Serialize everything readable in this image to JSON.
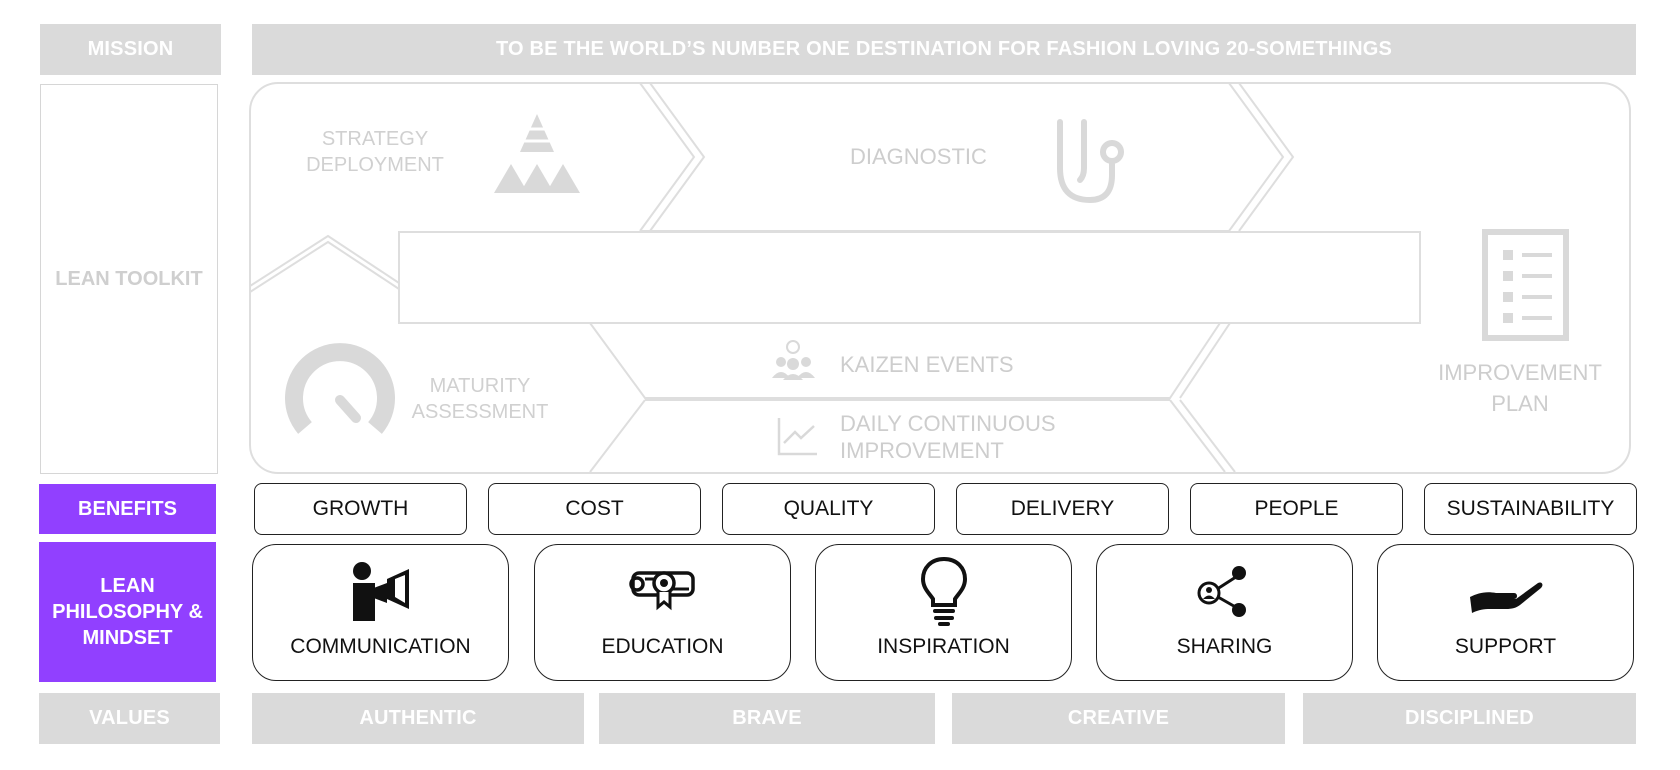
{
  "mission": {
    "label": "MISSION",
    "statement": "TO BE THE WORLD’S NUMBER ONE DESTINATION FOR FASHION LOVING 20-SOMETHINGS"
  },
  "toolkit": {
    "label": "LEAN TOOLKIT",
    "strategy": "STRATEGY DEPLOYMENT",
    "diagnostic": "DIAGNOSTIC",
    "maturity": "MATURITY ASSESSMENT",
    "kaizen": "KAIZEN EVENTS",
    "daily": "DAILY CONTINUOUS IMPROVEMENT",
    "improvement_plan": "IMPROVEMENT PLAN"
  },
  "benefits": {
    "label": "BENEFITS",
    "items": [
      "GROWTH",
      "COST",
      "QUALITY",
      "DELIVERY",
      "PEOPLE",
      "SUSTAINABILITY"
    ]
  },
  "philosophy": {
    "label": "LEAN PHILOSOPHY & MINDSET",
    "items": [
      {
        "label": "COMMUNICATION",
        "icon": "megaphone-icon"
      },
      {
        "label": "EDUCATION",
        "icon": "diploma-icon"
      },
      {
        "label": "INSPIRATION",
        "icon": "lightbulb-icon"
      },
      {
        "label": "SHARING",
        "icon": "share-icon"
      },
      {
        "label": "SUPPORT",
        "icon": "helping-hand-icon"
      }
    ]
  },
  "values": {
    "label": "VALUES",
    "items": [
      "AUTHENTIC",
      "BRAVE",
      "CREATIVE",
      "DISCIPLINED"
    ]
  },
  "colors": {
    "accent": "#9140ff",
    "grey_bar": "#dadada",
    "outline": "#222222",
    "faint": "#cdcdcd"
  }
}
